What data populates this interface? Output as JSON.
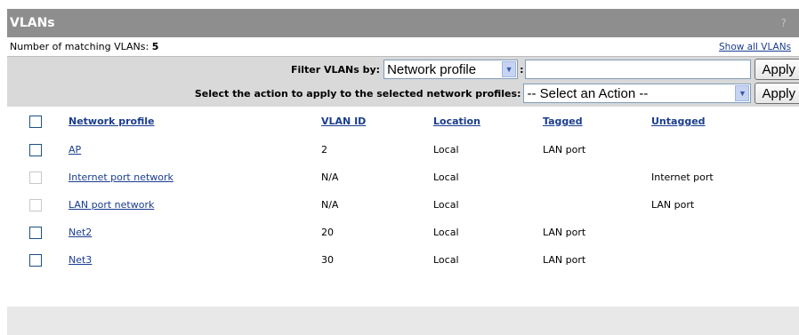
{
  "title": "VLANs",
  "help_label": "?",
  "count": {
    "label": "Number of matching VLANs:",
    "value": "5",
    "show_all": "Show all VLANs"
  },
  "filter": {
    "caption": "Filter VLANs by:",
    "selected": "Network profile",
    "colon": ":",
    "value": "",
    "apply_label": "Apply"
  },
  "action": {
    "caption": "Select the action to apply to the selected network profiles:",
    "selected": "-- Select an Action --",
    "apply_label": "Apply"
  },
  "table": {
    "headers": [
      "Network profile",
      "VLAN ID",
      "Location",
      "Tagged",
      "Untagged"
    ],
    "rows": [
      {
        "profile": "AP",
        "vlan_id": "2",
        "location": "Local",
        "tagged": "LAN port",
        "untagged": "",
        "checkbox_enabled": true
      },
      {
        "profile": "Internet port network",
        "vlan_id": "N/A",
        "location": "Local",
        "tagged": "",
        "untagged": "Internet port",
        "checkbox_enabled": false
      },
      {
        "profile": "LAN port network",
        "vlan_id": "N/A",
        "location": "Local",
        "tagged": "",
        "untagged": "LAN port",
        "checkbox_enabled": false
      },
      {
        "profile": "Net2",
        "vlan_id": "20",
        "location": "Local",
        "tagged": "LAN port",
        "untagged": "",
        "checkbox_enabled": true
      },
      {
        "profile": "Net3",
        "vlan_id": "30",
        "location": "Local",
        "tagged": "LAN port",
        "untagged": "",
        "checkbox_enabled": true
      }
    ]
  },
  "colors": {
    "title_bar": "#8e8e8e",
    "filter_bar": "#d9d9d9",
    "link": "#1a3d8f",
    "footer": "#e8e8e8"
  }
}
